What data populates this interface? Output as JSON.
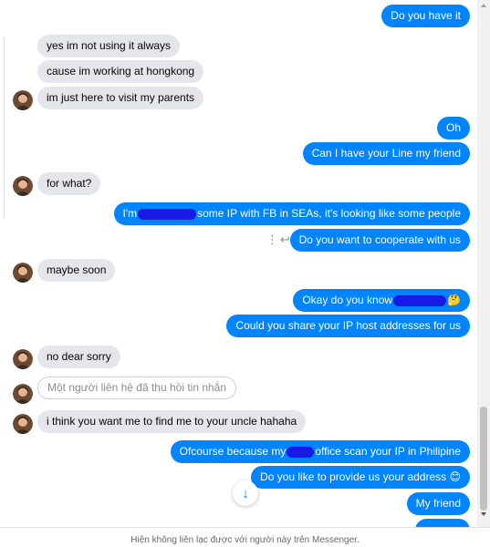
{
  "messages": {
    "m1": "Do you have it",
    "m2": "yes im not using it always",
    "m3": "cause im working at hongkong",
    "m4": "im just here to visit my parents",
    "m5": "Oh",
    "m6": "Can I have your Line my friend",
    "m7": "for what?",
    "m8_a": "I'm",
    "m8_b": "some IP with FB in SEAs, it's looking like some people",
    "m9": "Do you want to cooperate with us",
    "m10": "maybe soon",
    "m11_a": "Okay do you know",
    "m12": "Could you share your IP host addresses for us",
    "m13": "no dear sorry",
    "m14": "Một người liên hệ đã thu hồi tin nhắn",
    "m15": "i think you want me to find me to your uncle hahaha",
    "m16_a": "Ofcourse because my",
    "m16_b": "office scan your IP in Philipine",
    "m17": "Do you like to provide us your address",
    "m18": "My friend"
  },
  "emoji": {
    "thinking": "🤔",
    "smile": "😊"
  },
  "icons": {
    "more": "⋮",
    "reply": "↩",
    "scroll_down": "↓"
  },
  "footer": {
    "notice": "Hiện không liên lạc được với người này trên Messenger."
  },
  "colors": {
    "outgoing": "#0084ff",
    "incoming": "#e4e6eb",
    "redaction": "#1a1ae6"
  }
}
